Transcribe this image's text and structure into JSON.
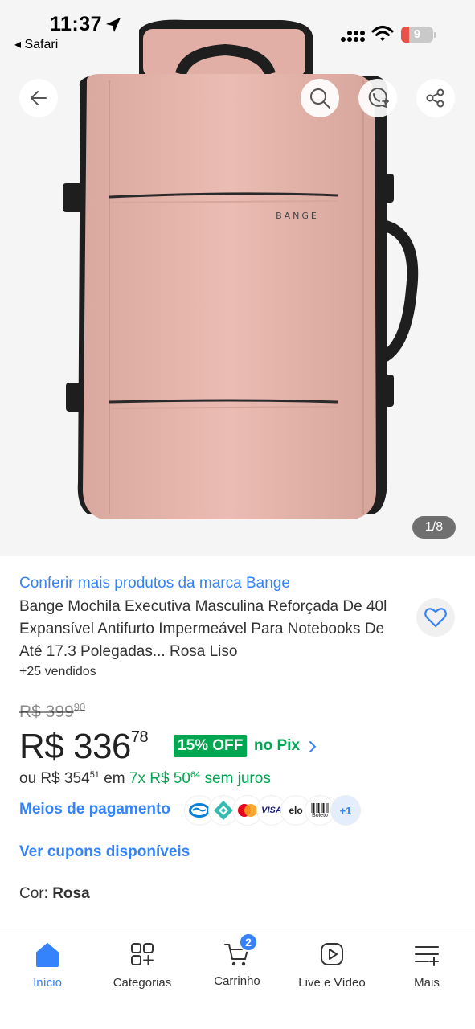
{
  "status_bar": {
    "time": "11:37",
    "back_app": "◂ Safari",
    "battery": "9"
  },
  "gallery": {
    "brand_print": "BANGE",
    "counter": "1/8"
  },
  "product": {
    "brand_link": "Conferir mais produtos da marca Bange",
    "title": "Bange Mochila Executiva Masculina Reforçada De 40l Expansível Antifurto Impermeável Para Notebooks De Até 17.3 Polegadas... Rosa Liso",
    "sold": "+25 vendidos"
  },
  "pricing": {
    "old_currency_int": "R$ 399",
    "old_cents": "90",
    "price_int": "R$ 336",
    "price_cents": "78",
    "discount_badge": "15% OFF",
    "discount_method": "no Pix",
    "install_prefix": "ou R$ 354",
    "install_prefix_cents": "51",
    "install_mid": " em ",
    "install_green": "7x R$ 50",
    "install_green_cents": "64",
    "install_suffix": " sem juros"
  },
  "payments": {
    "link": "Meios de pagamento",
    "icons": [
      "mercado-pago-icon",
      "pix-icon",
      "mastercard-icon",
      "visa-icon",
      "elo-icon",
      "boleto-icon"
    ],
    "visa_label": "VISA",
    "elo_label": "elo",
    "boleto_label": "Boleto",
    "more": "+1"
  },
  "coupons": {
    "link": "Ver cupons disponíveis"
  },
  "variant": {
    "label": "Cor:",
    "value": "Rosa"
  },
  "bottom_nav": {
    "items": [
      {
        "label": "Início",
        "icon": "home-icon",
        "active": true
      },
      {
        "label": "Categorias",
        "icon": "categories-icon",
        "active": false
      },
      {
        "label": "Carrinho",
        "icon": "cart-icon",
        "active": false,
        "badge": "2"
      },
      {
        "label": "Live e Vídeo",
        "icon": "play-icon",
        "active": false
      },
      {
        "label": "Mais",
        "icon": "menu-plus-icon",
        "active": false
      }
    ]
  },
  "colors": {
    "accent_blue": "#3483fa",
    "green": "#00a650",
    "bag_pink": "#e6b3aa"
  }
}
